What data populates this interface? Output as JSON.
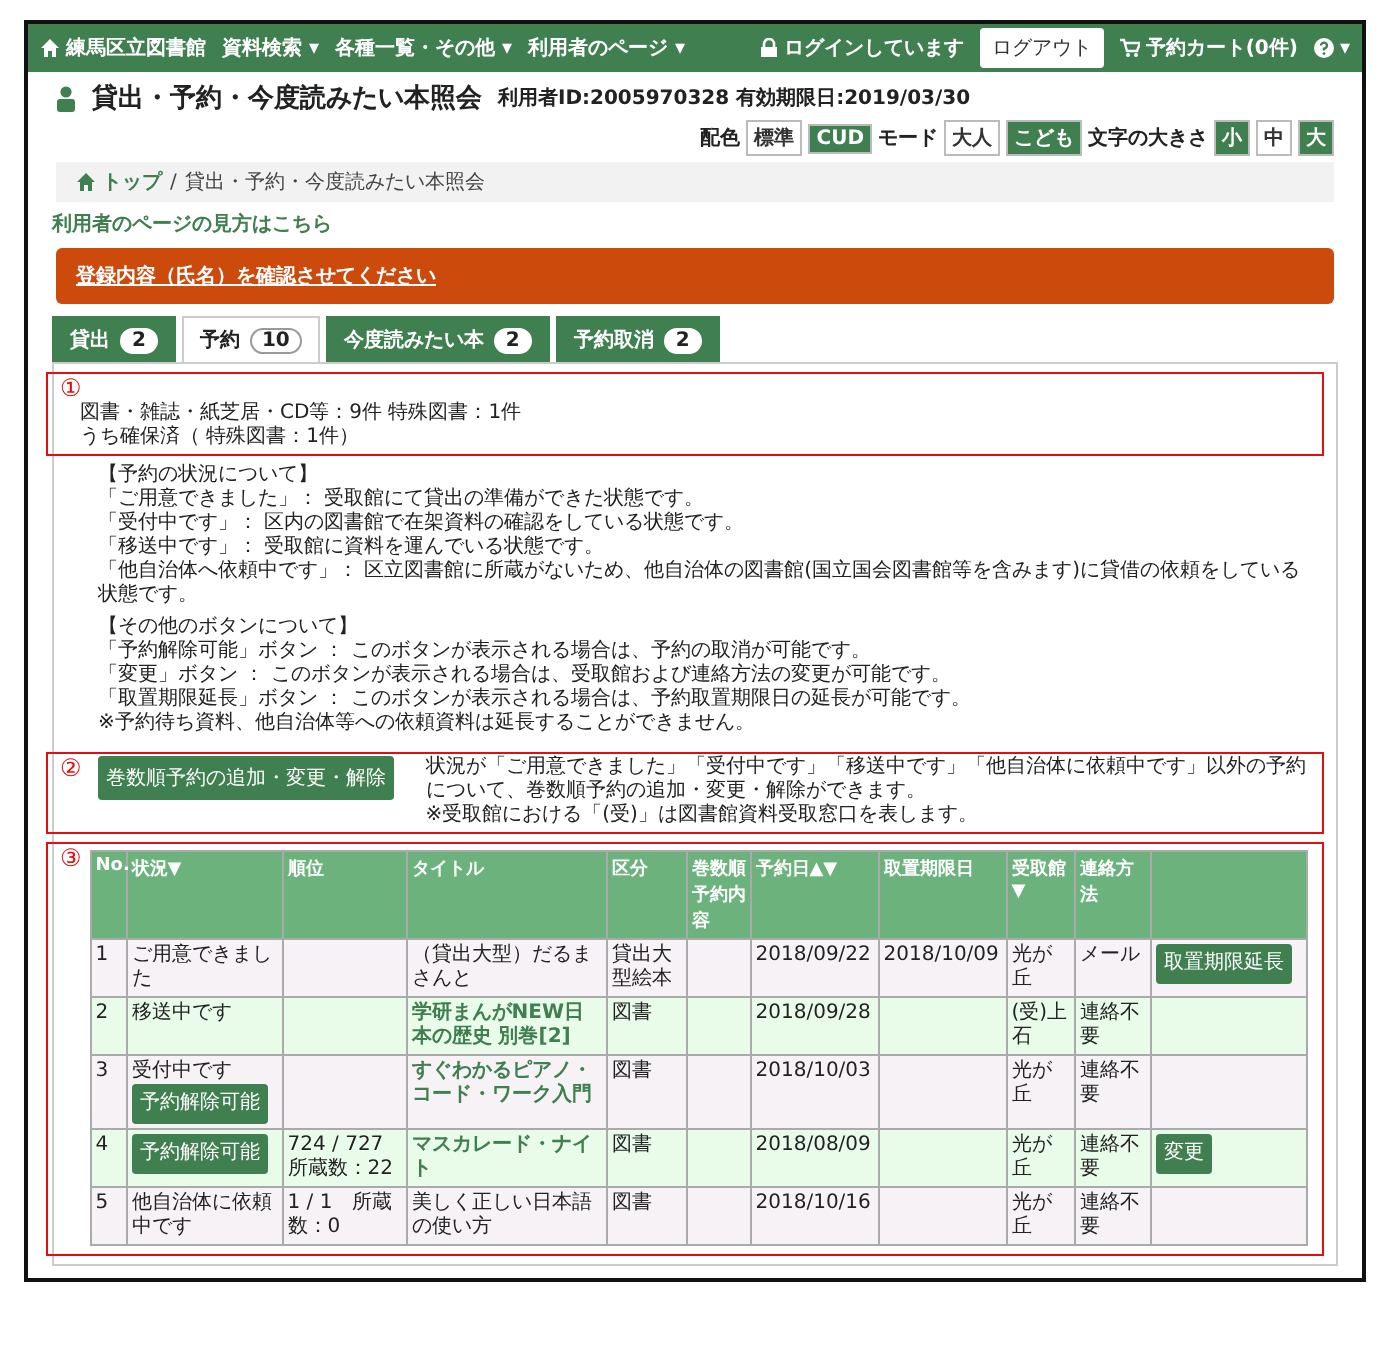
{
  "navbar": {
    "brand": "練馬区立図書館",
    "menus": [
      {
        "label": "資料検索",
        "caret": "▾"
      },
      {
        "label": "各種一覧・その他",
        "caret": "▾"
      },
      {
        "label": "利用者のページ",
        "caret": "▾"
      }
    ],
    "login_status": "ログインしています",
    "logout": "ログアウト",
    "cart": "予約カート(0件)",
    "help_caret": "▾"
  },
  "header": {
    "title": "貸出・予約・今度読みたい本照会",
    "user_info": "利用者ID:2005970328 有効期限日:2019/03/30",
    "settings": [
      {
        "label": "配色",
        "options": [
          {
            "label": "標準",
            "selected": true
          },
          {
            "label": "CUD",
            "selected": false
          }
        ]
      },
      {
        "label": "モード",
        "options": [
          {
            "label": "大人",
            "selected": true
          },
          {
            "label": "こども",
            "selected": false
          }
        ]
      },
      {
        "label": "文字の大きさ",
        "options": [
          {
            "label": "小",
            "selected": false
          },
          {
            "label": "中",
            "selected": true
          },
          {
            "label": "大",
            "selected": false
          }
        ]
      }
    ]
  },
  "breadcrumb": [
    {
      "label": "トップ",
      "link": true
    },
    {
      "label": "/",
      "link": false
    },
    {
      "label": "貸出・予約・今度読みたい本照会",
      "link": false
    }
  ],
  "help_link": "利用者のページの見方はこちら",
  "alert": "登録内容（氏名）を確認させてください",
  "tabs": [
    {
      "label": "貸出",
      "count": "2",
      "selected": false
    },
    {
      "label": "予約",
      "count": "10",
      "selected": true
    },
    {
      "label": "今度読みたい本",
      "count": "2",
      "selected": false
    },
    {
      "label": "予約取消",
      "count": "2",
      "selected": false
    }
  ],
  "section1": {
    "marker": "①",
    "lines": [
      "図書・雑誌・紙芝居・CD等：9件 特殊図書：1件",
      "うち確保済（ 特殊図書：1件）"
    ]
  },
  "info": [
    {
      "heading": "【予約の状況について】",
      "lines": [
        "「ご用意できました」： 受取館にて貸出の準備ができた状態です。",
        "「受付中です」： 区内の図書館で在架資料の確認をしている状態です。",
        "「移送中です」： 受取館に資料を運んでいる状態です。",
        "「他自治体へ依頼中です」： 区立図書館に所蔵がないため、他自治体の図書館(国立国会図書館等を含みます)に貸借の依頼をしている状態です。"
      ]
    },
    {
      "heading": "【その他のボタンについて】",
      "lines": [
        "「予約解除可能」ボタン ： このボタンが表示される場合は、予約の取消が可能です。",
        "「変更」ボタン ： このボタンが表示される場合は、受取館および連絡方法の変更が可能です。",
        "「取置期限延長」ボタン ： このボタンが表示される場合は、予約取置期限日の延長が可能です。",
        "※予約待ち資料、他自治体等への依頼資料は延長することができません。"
      ]
    }
  ],
  "section2": {
    "marker": "②",
    "button": "巻数順予約の追加・変更・解除",
    "lines": [
      "状況が「ご用意できました」「受付中です」「移送中です」「他自治体に依頼中です」以外の予約について、巻数順予約の追加・変更・解除ができます。",
      "※受取館における「(受)」は図書館資料受取窓口を表します。"
    ]
  },
  "section3": {
    "marker": "③",
    "table": {
      "columns": [
        {
          "label": "No."
        },
        {
          "label": "状況",
          "sort": "▼"
        },
        {
          "label": "順位"
        },
        {
          "label": "タイトル"
        },
        {
          "label": "区分"
        },
        {
          "label": "巻数順予約内容"
        },
        {
          "label": "予約日",
          "sort": "▲▼"
        },
        {
          "label": "取置期限日"
        },
        {
          "label": "受取館",
          "sort": "▼"
        },
        {
          "label": "連絡方法"
        },
        {}
      ],
      "rows": [
        {
          "no": "1",
          "status": "ご用意できました",
          "title": "（貸出大型）だるまさんと",
          "title_link": false,
          "category": "貸出大型絵本",
          "reserved": "2018/09/22",
          "hold_until": "2018/10/09",
          "pickup": "光が丘",
          "contact": "メール",
          "action": "取置期限延長"
        },
        {
          "no": "2",
          "status": "移送中です",
          "title": "学研まんがNEW日本の歴史 別巻[2]",
          "title_link": true,
          "category": "図書",
          "reserved": "2018/09/28",
          "pickup": "(受)上石",
          "contact": "連絡不要"
        },
        {
          "no": "3",
          "status": "受付中です",
          "status_button": "予約解除可能",
          "title": "すぐわかるピアノ・コード・ワーク入門",
          "title_link": true,
          "category": "図書",
          "reserved": "2018/10/03",
          "pickup": "光が丘",
          "contact": "連絡不要"
        },
        {
          "no": "4",
          "status_button": "予約解除可能",
          "rank": "724 / 727　所蔵数：22",
          "title": "マスカレード・ナイト",
          "title_link": true,
          "category": "図書",
          "reserved": "2018/08/09",
          "pickup": "光が丘",
          "contact": "連絡不要",
          "action": "変更"
        },
        {
          "no": "5",
          "status": "他自治体に依頼中です",
          "rank": "1 / 1　所蔵数：0",
          "title": "美しく正しい日本語の使い方",
          "title_link": false,
          "category": "図書",
          "reserved": "2018/10/16",
          "pickup": "光が丘",
          "contact": "連絡不要"
        }
      ]
    }
  }
}
